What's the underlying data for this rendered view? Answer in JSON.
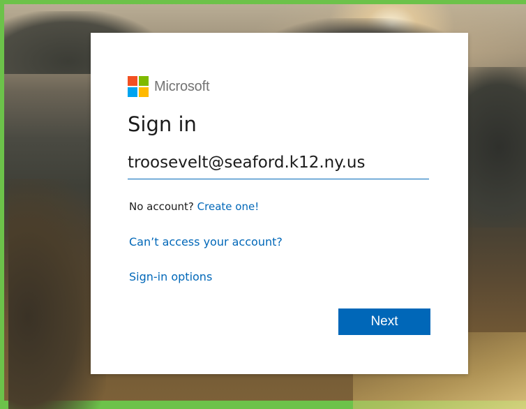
{
  "brand": {
    "name": "Microsoft",
    "logo_colors": [
      "#f25022",
      "#7fba00",
      "#00a4ef",
      "#ffb900"
    ]
  },
  "signin": {
    "title": "Sign in",
    "email_value": "troosevelt@seaford.k12.ny.us",
    "no_account_text": "No account?",
    "create_link": "Create one!",
    "cant_access_link": "Can’t access your account?",
    "options_link": "Sign-in options",
    "next_button": "Next"
  },
  "colors": {
    "accent": "#0067b8",
    "frame": "#6cc24a"
  }
}
